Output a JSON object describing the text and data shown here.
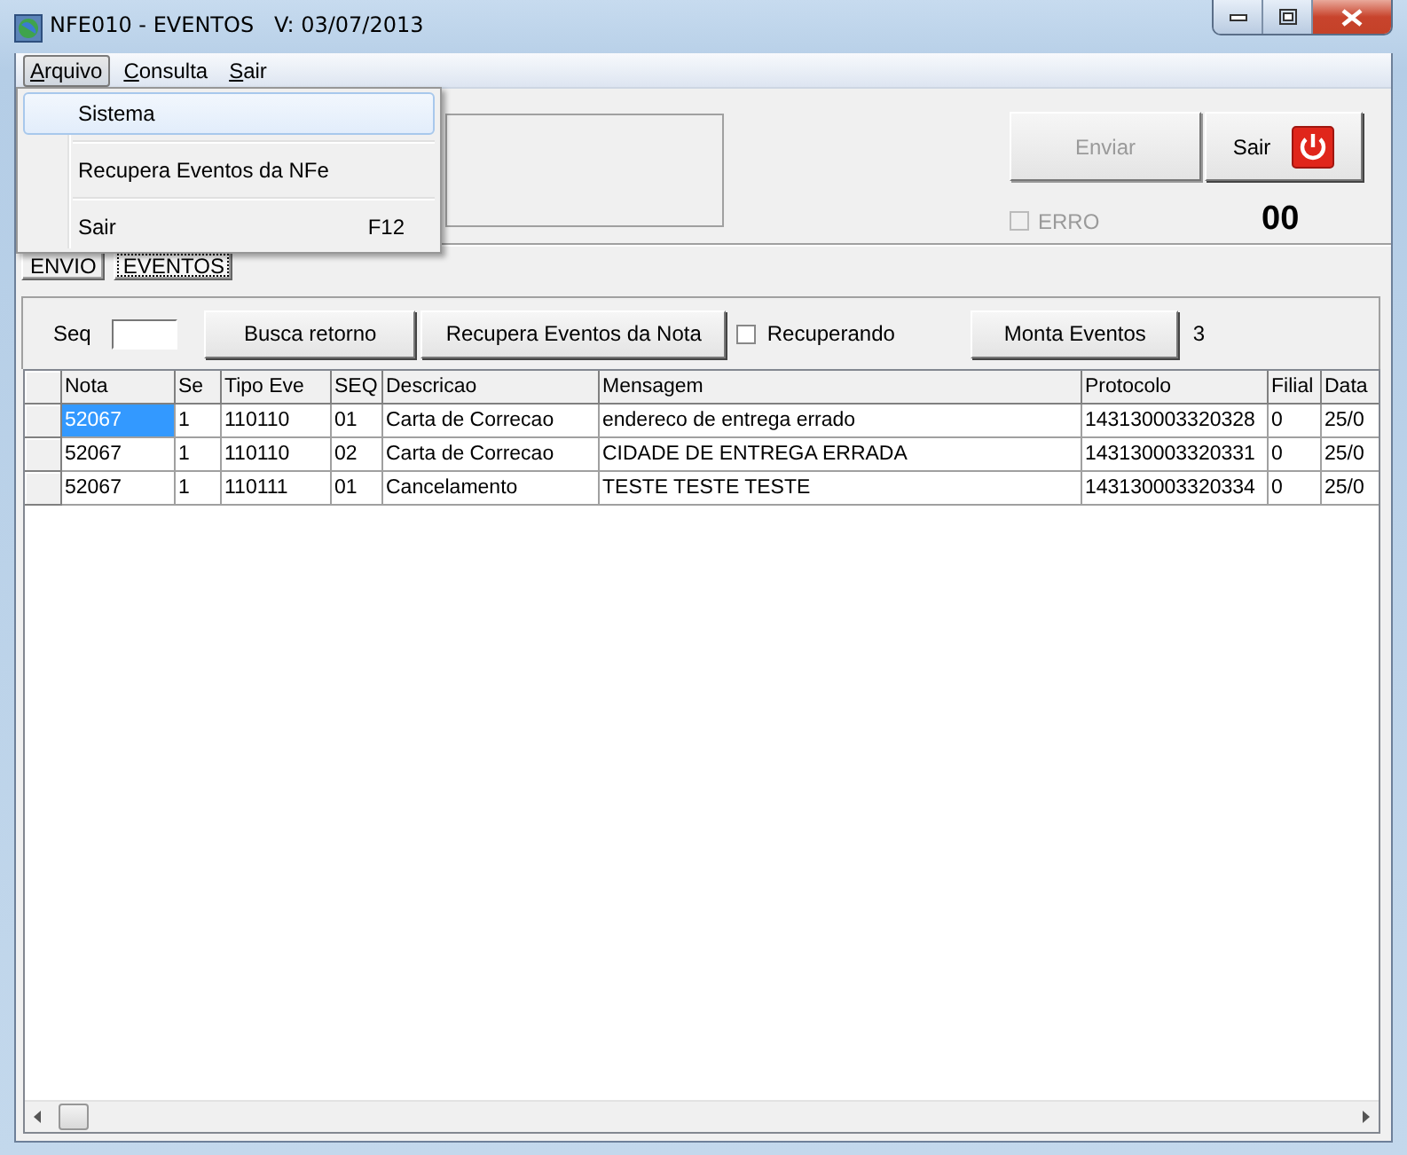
{
  "window": {
    "title": "NFE010 - EVENTOS   V: 03/07/2013"
  },
  "menu_bar": [
    {
      "label": "Arquivo",
      "open": true
    },
    {
      "label": "Consulta",
      "open": false
    },
    {
      "label": "Sair",
      "open": false
    }
  ],
  "dropdown": [
    {
      "label": "Sistema",
      "selected": true
    },
    {
      "label": "Recupera Eventos da NFe",
      "selected": false
    },
    {
      "label": "Sair",
      "shortcut": "F12",
      "selected": false
    }
  ],
  "top_panel": {
    "buttons": [
      {
        "label": "Enviar",
        "kind": "text",
        "disabled": true
      },
      {
        "label": "Sair",
        "kind": "power",
        "disabled": false
      }
    ],
    "erro_checkbox": {
      "label": "ERRO",
      "checked": false,
      "disabled": true
    },
    "counter": "00"
  },
  "tabs": [
    {
      "label": "ENVIO",
      "selected": false
    },
    {
      "label": "EVENTOS",
      "selected": true
    }
  ],
  "toolbar": {
    "seq_label": "Seq",
    "busca_button": "Busca retorno",
    "recupera_button": "Recupera Eventos da Nota",
    "recuperando_checkbox": {
      "label": "Recuperando",
      "checked": false
    },
    "monta_button": "Monta Eventos",
    "count": "3"
  },
  "table": {
    "columns": [
      "Nota",
      "Se",
      "Tipo Eve",
      "SEQ",
      "Descricao",
      "Mensagem",
      "Protocolo",
      "Filial",
      "Data"
    ],
    "rows": [
      {
        "selected": true,
        "cells": [
          "52067",
          "1",
          "110110",
          "01",
          "Carta de Correcao",
          "endereco de entrega errado",
          "143130003320328",
          "0",
          "25/0"
        ]
      },
      {
        "selected": false,
        "cells": [
          "52067",
          "1",
          "110110",
          "02",
          "Carta de Correcao",
          "CIDADE DE ENTREGA ERRADA",
          "143130003320331",
          "0",
          "25/0"
        ]
      },
      {
        "selected": false,
        "cells": [
          "52067",
          "1",
          "110111",
          "01",
          "Cancelamento",
          "TESTE TESTE TESTE",
          "143130003320334",
          "0",
          "25/0"
        ]
      }
    ]
  }
}
